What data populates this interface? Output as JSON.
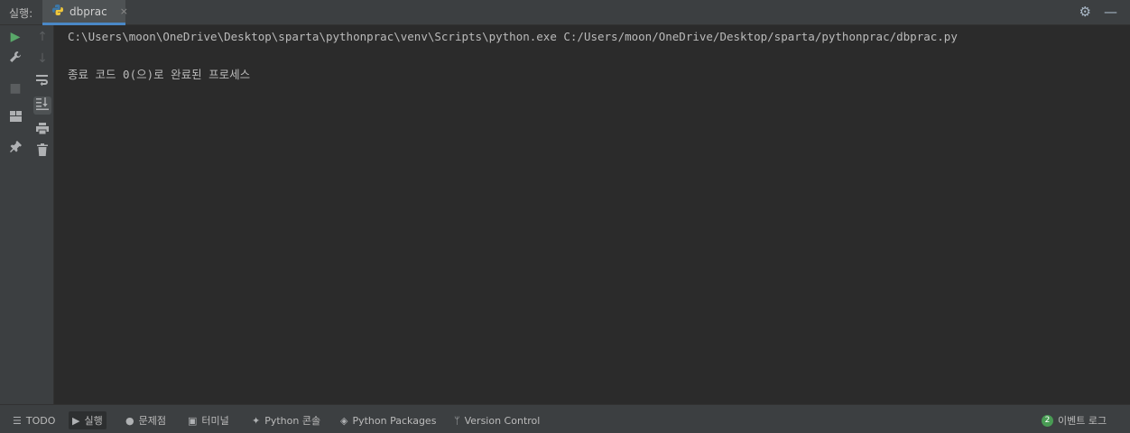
{
  "header": {
    "run_label": "실행:",
    "tab_name": "dbprac",
    "tab_close": "×",
    "settings_icon": "⚙",
    "minimize_icon": "—"
  },
  "toolbar": {
    "left": [
      {
        "name": "run-button",
        "icon": "▶",
        "color": "#59a869"
      },
      {
        "name": "wrench-button",
        "icon": "🔧",
        "color": "#afb1b3"
      },
      {
        "name": "stop-button",
        "icon": "■",
        "color": "#5a5d5f"
      },
      {
        "name": "layout-button",
        "icon": "▦",
        "color": "#afb1b3"
      },
      {
        "name": "pin-button",
        "icon": "📌",
        "color": "#afb1b3"
      }
    ],
    "right": [
      {
        "name": "up-arrow-button",
        "icon": "↑",
        "color": "#5a5d5f"
      },
      {
        "name": "down-arrow-button",
        "icon": "↓",
        "color": "#5a5d5f"
      },
      {
        "name": "soft-wrap-button",
        "icon": "⤶",
        "color": "#afb1b3"
      },
      {
        "name": "scroll-to-end-button",
        "icon": "⇊",
        "color": "#afb1b3"
      },
      {
        "name": "print-button",
        "icon": "⎙",
        "color": "#afb1b3"
      },
      {
        "name": "trash-button",
        "icon": "🗑",
        "color": "#afb1b3"
      }
    ]
  },
  "console": {
    "command": "C:\\Users\\moon\\OneDrive\\Desktop\\sparta\\pythonprac\\venv\\Scripts\\python.exe C:/Users/moon/OneDrive/Desktop/sparta/pythonprac/dbprac.py",
    "exit_message": "종료 코드 0(으)로 완료된 프로세스"
  },
  "statusbar": {
    "items": [
      {
        "label": "TODO",
        "icon": "☰"
      },
      {
        "label": "실행",
        "icon": "▶"
      },
      {
        "label": "문제점",
        "icon": "●"
      },
      {
        "label": "터미널",
        "icon": "▣"
      },
      {
        "label": "Python 콘솔",
        "icon": "✦"
      },
      {
        "label": "Python Packages",
        "icon": "◈"
      },
      {
        "label": "Version Control",
        "icon": "ᛘ"
      }
    ],
    "event_count": "2",
    "event_label": "이벤트 로그"
  }
}
